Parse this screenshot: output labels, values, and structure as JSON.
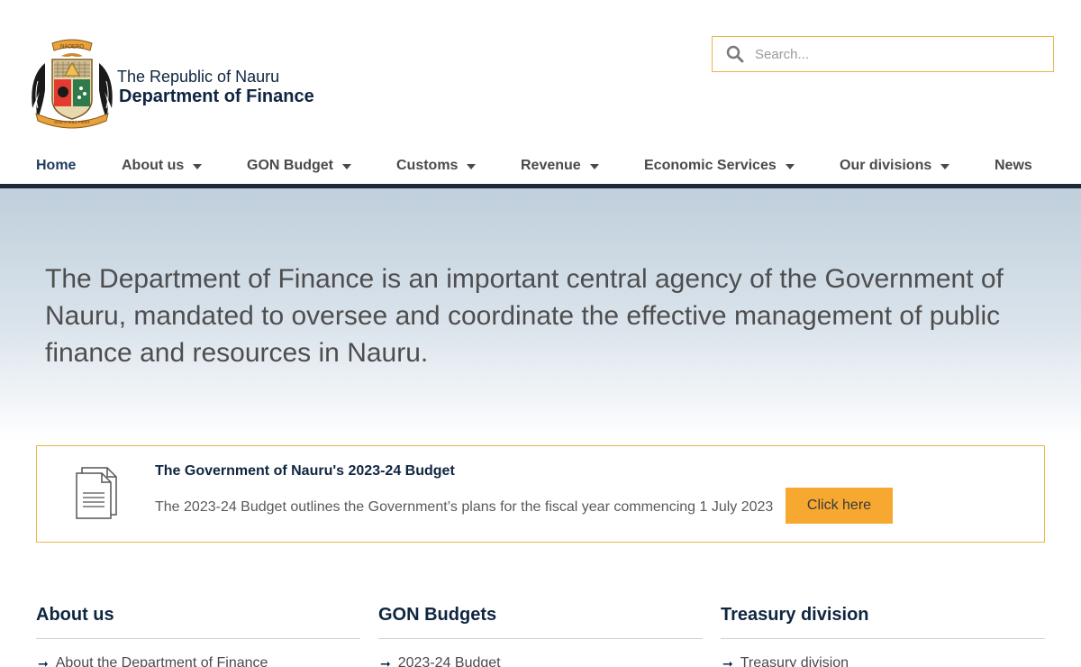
{
  "header": {
    "brand_line1": "The Republic of Nauru",
    "brand_line2": "Department of Finance",
    "seal_text_top": "NAOERO",
    "seal_text_bottom": "GOD'S WILL FIRST"
  },
  "search": {
    "placeholder": "Search..."
  },
  "nav": {
    "items": [
      {
        "label": "Home",
        "active": true,
        "dropdown": false
      },
      {
        "label": "About us",
        "active": false,
        "dropdown": true
      },
      {
        "label": "GON Budget",
        "active": false,
        "dropdown": true
      },
      {
        "label": "Customs",
        "active": false,
        "dropdown": true
      },
      {
        "label": "Revenue",
        "active": false,
        "dropdown": true
      },
      {
        "label": "Economic Services",
        "active": false,
        "dropdown": true
      },
      {
        "label": "Our divisions",
        "active": false,
        "dropdown": true
      },
      {
        "label": "News",
        "active": false,
        "dropdown": false
      }
    ]
  },
  "hero": {
    "text": "The Department of Finance is an important central agency of the Government of Nauru, mandated to oversee and coordinate the effective management of public finance and resources in Nauru."
  },
  "budget": {
    "title": "The Government of Nauru's 2023-24 Budget",
    "description": "The 2023-24 Budget outlines the Government’s plans for the fiscal year commencing 1 July 2023",
    "button_label": "Click here"
  },
  "columns": [
    {
      "heading": "About us",
      "link": "About the Department of Finance"
    },
    {
      "heading": "GON Budgets",
      "link": "2023-24 Budget"
    },
    {
      "heading": "Treasury division",
      "link": "Treasury division"
    }
  ],
  "colors": {
    "accent_orange": "#f6a831",
    "border_gold": "#e6b84a",
    "navy": "#0f2540",
    "nav_bar": "#1b2a36"
  }
}
